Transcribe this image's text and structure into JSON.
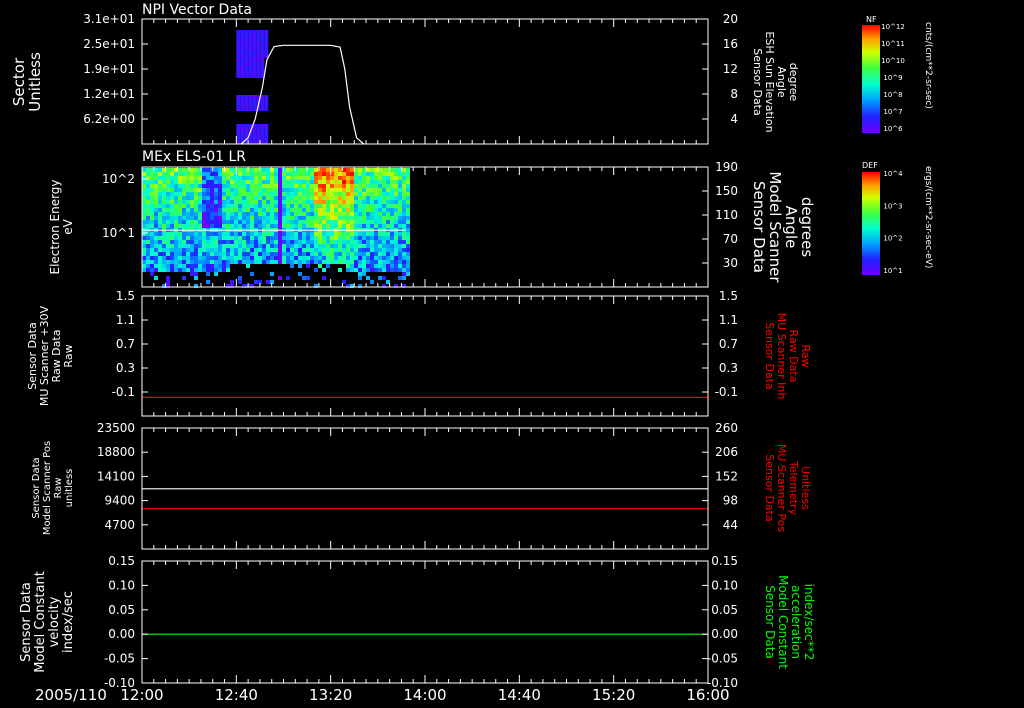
{
  "date_label": "2005/110",
  "x_ticks": [
    "12:00",
    "12:40",
    "13:20",
    "14:00",
    "14:40",
    "15:20",
    "16:00"
  ],
  "colorbars": [
    {
      "title": "NF",
      "unit": "cnts/(cm**2-sr-sec)",
      "tick_labels": [
        "10^12",
        "10^11",
        "10^10",
        "10^9",
        "10^8",
        "10^7",
        "10^6"
      ]
    },
    {
      "title": "DEF",
      "unit": "ergs/(cm**2-sr-sec-eV)",
      "tick_labels": [
        "10^4",
        "10^3",
        "10^2",
        "10^1"
      ]
    }
  ],
  "chart_data": [
    {
      "type": "heatmap",
      "title": "NPI Vector Data",
      "ylabel_left": [
        "Sector",
        "Unitless"
      ],
      "yticks_left": [
        "3.1e+01",
        "2.5e+01",
        "1.9e+01",
        "1.2e+01",
        "6.2e+00"
      ],
      "ylabel_right": [
        "Sensor Data",
        "ESH Sun Elevation",
        "Angle",
        "degree"
      ],
      "yticks_right": [
        "20",
        "16",
        "12",
        "8",
        "4"
      ],
      "ylim_right": [
        0,
        20
      ],
      "heatmap_time_range": [
        "12:40",
        "12:53"
      ],
      "overlay_series": {
        "name": "Sensor Data ESH Sun Elevation Angle",
        "color": "#ffffff",
        "x": [
          "12:42",
          "12:45",
          "12:48",
          "12:51",
          "12:53",
          "12:56",
          "13:00",
          "13:10",
          "13:20",
          "13:24",
          "13:26",
          "13:28",
          "13:31",
          "13:34"
        ],
        "y": [
          0,
          1,
          4,
          9,
          13.5,
          15.6,
          15.8,
          15.8,
          15.8,
          15.5,
          12,
          6,
          1,
          0
        ]
      }
    },
    {
      "type": "heatmap",
      "title": "MEx ELS-01 LR",
      "ylabel_left": [
        "Electron Energy",
        "eV"
      ],
      "yticks_left": [
        "10^2",
        "10^1"
      ],
      "ylabel_right": [
        "Sensor Data",
        "Model Scanner",
        "Angle",
        "degrees"
      ],
      "yticks_right": [
        "190",
        "150",
        "110",
        "70",
        "30"
      ],
      "ylim_right": [
        0,
        190
      ],
      "heatmap_time_range": [
        "12:00",
        "13:52"
      ],
      "overlay_series": {
        "name": "Sensor Data Model Scanner Angle",
        "color": "#ffffff",
        "x": [
          "12:00",
          "13:52"
        ],
        "y": [
          90,
          90
        ]
      }
    },
    {
      "type": "line",
      "ylabel_left": [
        "Sensor Data",
        "MU Scanner +30V",
        "Raw Data",
        "Raw"
      ],
      "yticks_left": [
        "1.5",
        "1.1",
        "0.7",
        "0.3",
        "-0.1"
      ],
      "ylabel_right": [
        "Sensor Data",
        "MU Scanner Inh",
        "Raw Data",
        "Raw"
      ],
      "yticks_right": [
        "1.5",
        "1.1",
        "0.7",
        "0.3",
        "-0.1"
      ],
      "right_label_color": "#ff0000",
      "ylim": [
        -0.3,
        1.5
      ],
      "series": [
        {
          "name": "Sensor Data MU Scanner Inh Raw Data",
          "color": "#ff0000",
          "x": [
            "12:00",
            "16:00"
          ],
          "y": [
            -0.02,
            -0.02
          ]
        }
      ]
    },
    {
      "type": "line",
      "ylabel_left": [
        "Sensor Data",
        "Model Scanner Pos",
        "Raw",
        "unitless"
      ],
      "yticks_left": [
        "23500",
        "18800",
        "14100",
        "9400",
        "4700"
      ],
      "ylabel_right": [
        "Sensor Data",
        "MU Scanner Pos",
        "Telemetry",
        "Unitless"
      ],
      "yticks_right": [
        "260",
        "206",
        "152",
        "98",
        "44"
      ],
      "right_label_color": "#ff0000",
      "ylim_left": [
        0,
        23500
      ],
      "ylim_right": [
        -10,
        260
      ],
      "series": [
        {
          "name": "Sensor Data Model Scanner Pos Raw",
          "color": "#ffffff",
          "axis": "left",
          "x": [
            "12:00",
            "16:00"
          ],
          "y": [
            11700,
            11700
          ]
        },
        {
          "name": "Sensor Data MU Scanner Pos Telemetry",
          "color": "#ff0000",
          "axis": "right",
          "x": [
            "12:00",
            "16:00"
          ],
          "y": [
            80,
            80
          ]
        }
      ]
    },
    {
      "type": "line",
      "ylabel_left": [
        "Sensor Data",
        "Model Constant",
        "velocity",
        "index/sec"
      ],
      "yticks_left": [
        "0.15",
        "0.10",
        "0.05",
        "0.00",
        "-0.05",
        "-0.10"
      ],
      "ylabel_right": [
        "Sensor Data",
        "Model Constant",
        "acceleration",
        "index/sec**2"
      ],
      "yticks_right": [
        "0.15",
        "0.10",
        "0.05",
        "0.00",
        "-0.05",
        "-0.10"
      ],
      "right_label_color": "#00ff00",
      "ylim": [
        -0.1,
        0.15
      ],
      "series": [
        {
          "name": "Sensor Data Model Constant acceleration",
          "color": "#00ff00",
          "x": [
            "12:00",
            "16:00"
          ],
          "y": [
            0,
            0
          ]
        }
      ]
    }
  ]
}
